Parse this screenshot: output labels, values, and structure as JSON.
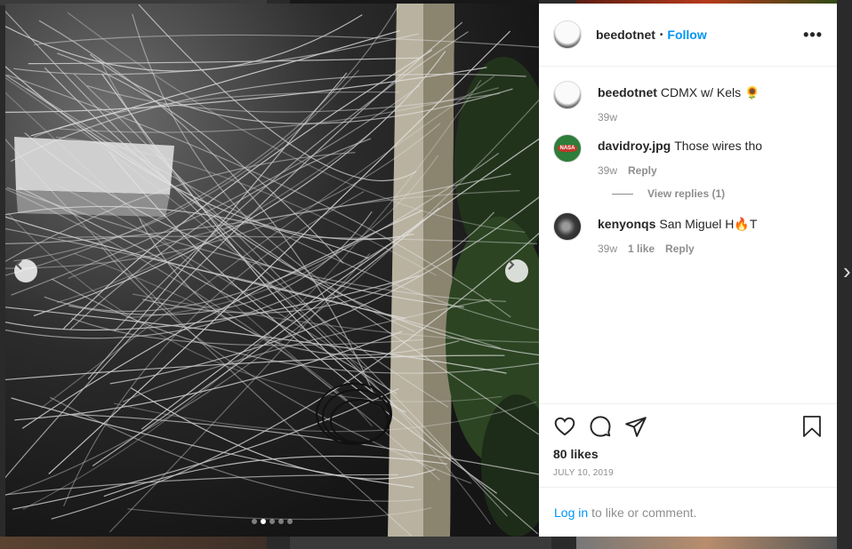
{
  "post": {
    "username": "beedotnet",
    "follow_label": "Follow",
    "separator": "•",
    "more_label": "•••"
  },
  "photo": {
    "slide_count": 5,
    "active_slide": 2
  },
  "comments": [
    {
      "user": "beedotnet",
      "text": "CDMX w/ Kels 🌻",
      "age": "39w",
      "likes": "",
      "reply": ""
    },
    {
      "user": "davidroy.jpg",
      "text": "Those wires tho",
      "age": "39w",
      "likes": "",
      "reply": "Reply"
    },
    {
      "user": "kenyonqs",
      "text": "San Miguel H🔥T",
      "age": "39w",
      "likes": "1 like",
      "reply": "Reply"
    }
  ],
  "view_replies_label": "View replies (1)",
  "likes_label": "80 likes",
  "date_label": "JULY 10, 2019",
  "login": {
    "link": "Log in",
    "rest": "to like or comment."
  },
  "avatar_badges": {
    "nasa": "NASA"
  },
  "colors": {
    "accent": "#0095f6",
    "muted": "#8e8e8e",
    "text": "#262626"
  }
}
